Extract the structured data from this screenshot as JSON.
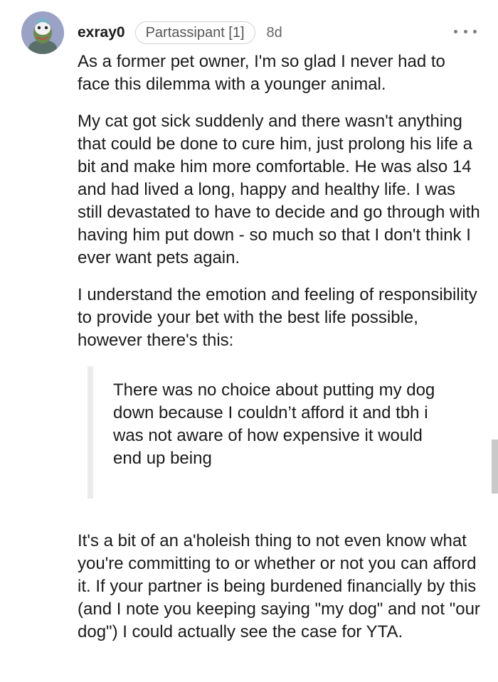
{
  "comment": {
    "author": "exray0",
    "flair": "Partassipant [1]",
    "age": "8d",
    "avatar_icon": "user-avatar-icon",
    "more_icon": "more-options-icon",
    "paragraphs": [
      "As a former pet owner, I'm so glad I never had to face this dilemma with a younger animal.",
      "My cat got sick suddenly and there wasn't anything that could be done to cure him, just prolong his life a bit and make him more comfortable. He was also 14 and had lived a long, happy and healthy life. I was still devastated to have to decide and go through with having him put down - so much so that I don't think I ever want pets again.",
      "I understand the emotion and feeling of responsibility to provide your bet with the best life possible, however there's this:"
    ],
    "quote": "There was no choice about putting my dog down because I couldn’t afford it and tbh i was not aware of how expensive it would end up being",
    "closing": "It's a bit of an a'holeish thing to not even know what you're committing to or whether or not you can afford it. If your partner is being burdened financially by this (and I note you keeping saying \"my dog\" and not \"our dog\") I could actually see the case for YTA."
  },
  "colors": {
    "text": "#1a1a1b",
    "muted": "#666666",
    "quote_bar": "#ebebeb"
  }
}
